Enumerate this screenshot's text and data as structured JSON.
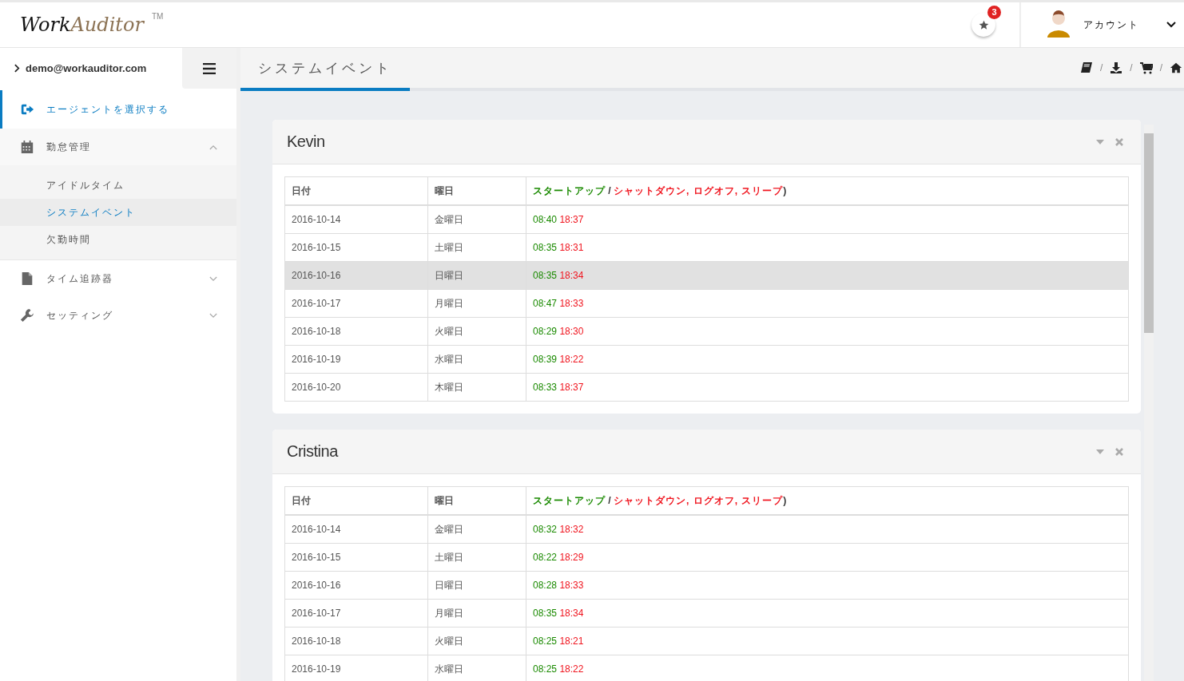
{
  "header": {
    "logo": {
      "part_1": "Work",
      "part_2": "Auditor",
      "mark": "TM"
    },
    "notifications": {
      "count": "3"
    },
    "account": {
      "label": "アカウント"
    }
  },
  "sidebar": {
    "user": "demo@workauditor.com",
    "items": [
      {
        "label": "エージェントを選択する",
        "kind": "exit",
        "selected": true
      },
      {
        "label": "勤怠管理",
        "kind": "calendar",
        "selected": false,
        "expanded": true,
        "children": [
          {
            "label": "アイドルタイム",
            "selected": false
          },
          {
            "label": "システムイベント",
            "selected": true
          },
          {
            "label": "欠勤時間",
            "selected": false
          }
        ]
      },
      {
        "label": "タイム追跡器",
        "kind": "file",
        "selected": false,
        "expanded": false
      },
      {
        "label": "セッティング",
        "kind": "wrench",
        "selected": false,
        "expanded": false
      }
    ]
  },
  "page_title": "システムイベント",
  "breadcrumb": [
    {
      "kind": "book"
    },
    {
      "kind": "download"
    },
    {
      "kind": "cart"
    },
    {
      "kind": "home"
    }
  ],
  "separator": "/",
  "panels": [
    {
      "title": "Kevin",
      "columns": [
        "日付",
        "曜日"
      ],
      "event_column": [
        {
          "text": "スタートアップ",
          "kind": "startup"
        },
        {
          "text": " / ",
          "kind": "plain"
        },
        {
          "text": "シャットダウン, ログオフ, スリープ",
          "kind": "shutdown"
        },
        {
          "text": ")",
          "kind": "plain"
        }
      ],
      "rows": [
        {
          "date": "2016-10-14",
          "weekday": "金曜日",
          "start": "08:40",
          "end": "18:37",
          "selected": false
        },
        {
          "date": "2016-10-15",
          "weekday": "土曜日",
          "start": "08:35",
          "end": "18:31",
          "selected": false
        },
        {
          "date": "2016-10-16",
          "weekday": "日曜日",
          "start": "08:35",
          "end": "18:34",
          "selected": true
        },
        {
          "date": "2016-10-17",
          "weekday": "月曜日",
          "start": "08:47",
          "end": "18:33",
          "selected": false
        },
        {
          "date": "2016-10-18",
          "weekday": "火曜日",
          "start": "08:29",
          "end": "18:30",
          "selected": false
        },
        {
          "date": "2016-10-19",
          "weekday": "水曜日",
          "start": "08:39",
          "end": "18:22",
          "selected": false
        },
        {
          "date": "2016-10-20",
          "weekday": "木曜日",
          "start": "08:33",
          "end": "18:37",
          "selected": false
        }
      ]
    },
    {
      "title": "Cristina",
      "columns": [
        "日付",
        "曜日"
      ],
      "event_column": [
        {
          "text": "スタートアップ",
          "kind": "startup"
        },
        {
          "text": " / ",
          "kind": "plain"
        },
        {
          "text": "シャットダウン, ログオフ, スリープ",
          "kind": "shutdown"
        },
        {
          "text": ")",
          "kind": "plain"
        }
      ],
      "rows": [
        {
          "date": "2016-10-14",
          "weekday": "金曜日",
          "start": "08:32",
          "end": "18:32",
          "selected": false
        },
        {
          "date": "2016-10-15",
          "weekday": "土曜日",
          "start": "08:22",
          "end": "18:29",
          "selected": false
        },
        {
          "date": "2016-10-16",
          "weekday": "日曜日",
          "start": "08:28",
          "end": "18:33",
          "selected": false
        },
        {
          "date": "2016-10-17",
          "weekday": "月曜日",
          "start": "08:35",
          "end": "18:34",
          "selected": false
        },
        {
          "date": "2016-10-18",
          "weekday": "火曜日",
          "start": "08:25",
          "end": "18:21",
          "selected": false
        },
        {
          "date": "2016-10-19",
          "weekday": "水曜日",
          "start": "08:25",
          "end": "18:22",
          "selected": false
        }
      ]
    }
  ]
}
